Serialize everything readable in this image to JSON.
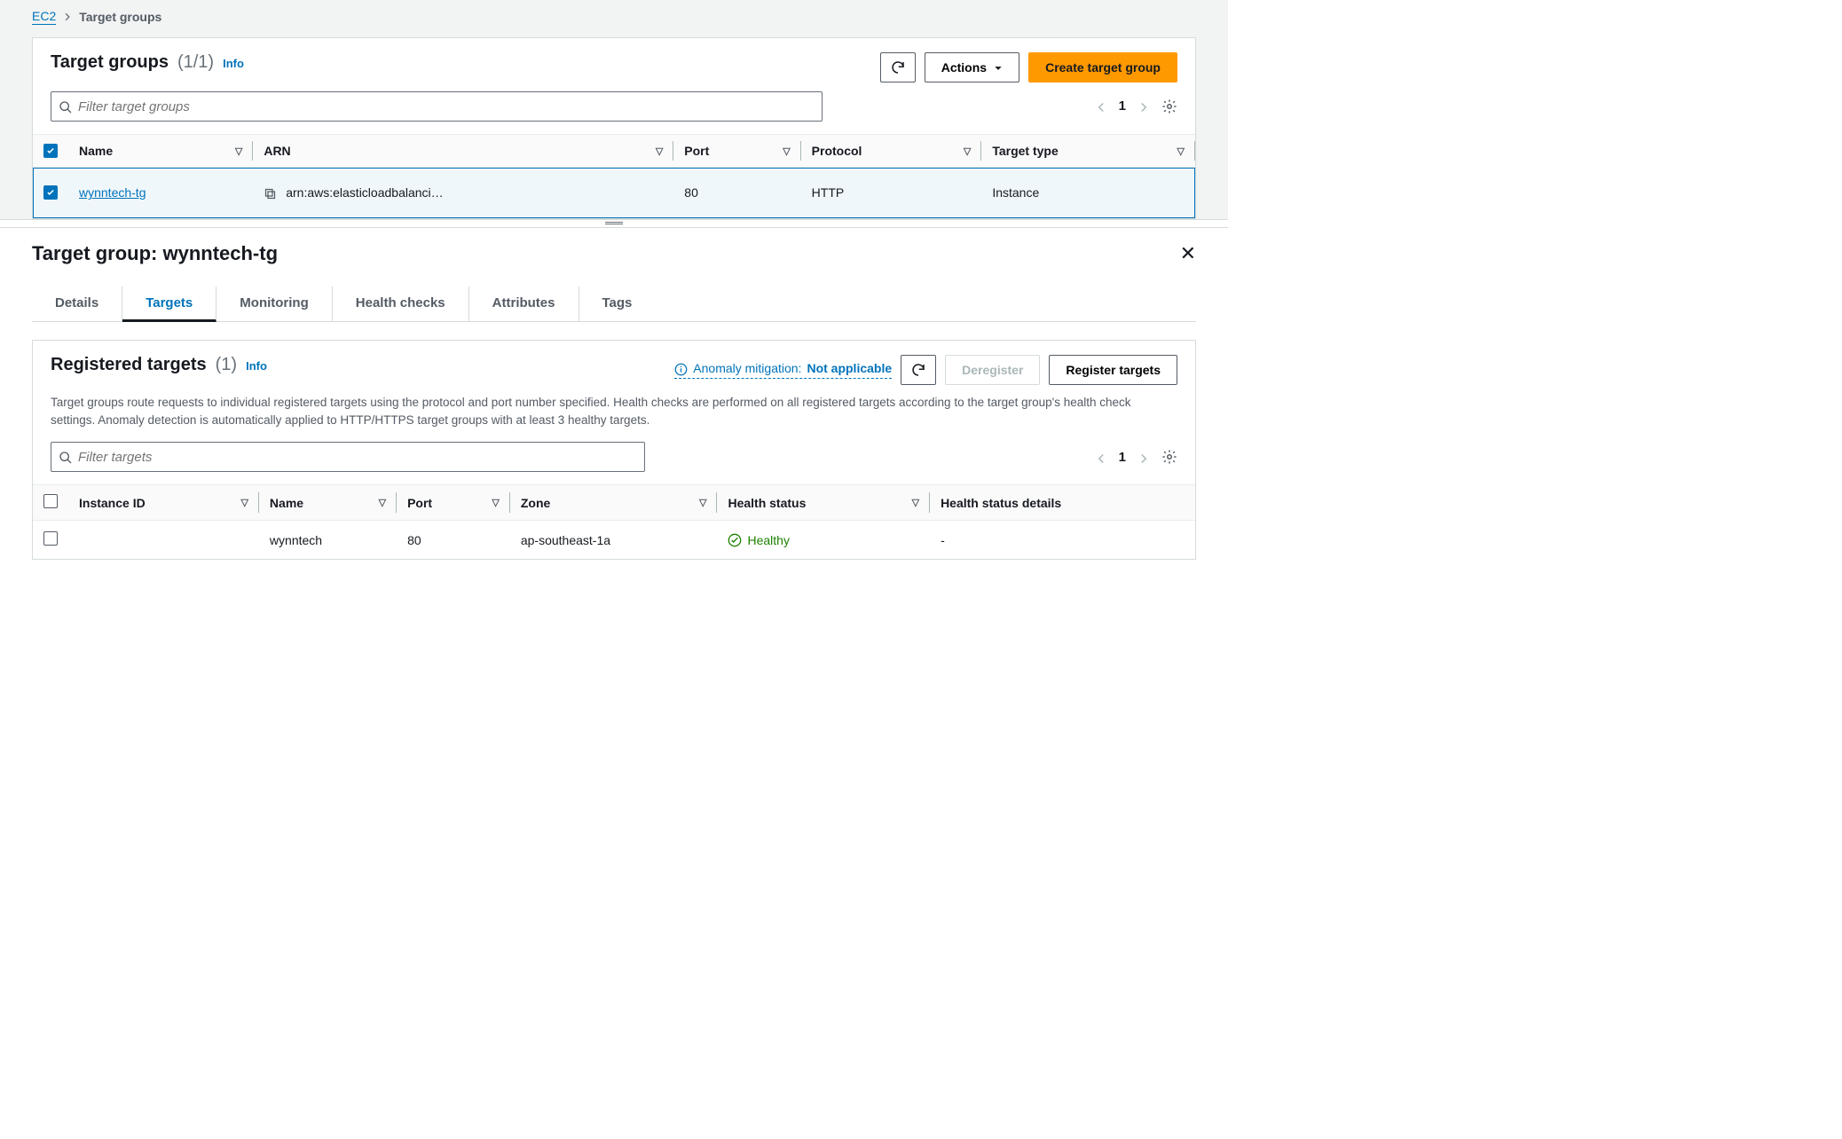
{
  "breadcrumb": {
    "root": "EC2",
    "current": "Target groups"
  },
  "tg_panel": {
    "title": "Target groups",
    "count": "(1/1)",
    "info": "Info",
    "actions_label": "Actions",
    "create_label": "Create target group",
    "filter_placeholder": "Filter target groups",
    "page": "1",
    "columns": {
      "name": "Name",
      "arn": "ARN",
      "port": "Port",
      "protocol": "Protocol",
      "target_type": "Target type"
    },
    "row": {
      "name": "wynntech-tg",
      "arn": "arn:aws:elasticloadbalanci…",
      "port": "80",
      "protocol": "HTTP",
      "target_type": "Instance"
    }
  },
  "detail": {
    "title_prefix": "Target group: ",
    "title_name": "wynntech-tg",
    "tabs": {
      "details": "Details",
      "targets": "Targets",
      "monitoring": "Monitoring",
      "health": "Health checks",
      "attributes": "Attributes",
      "tags": "Tags"
    }
  },
  "targets": {
    "title": "Registered targets",
    "count": "(1)",
    "info": "Info",
    "anomaly_label": "Anomaly mitigation: ",
    "anomaly_value": "Not applicable",
    "deregister": "Deregister",
    "register": "Register targets",
    "desc": "Target groups route requests to individual registered targets using the protocol and port number specified. Health checks are performed on all registered targets according to the target group's health check settings. Anomaly detection is automatically applied to HTTP/HTTPS target groups with at least 3 healthy targets.",
    "filter_placeholder": "Filter targets",
    "page": "1",
    "columns": {
      "instance_id": "Instance ID",
      "name": "Name",
      "port": "Port",
      "zone": "Zone",
      "health": "Health status",
      "health_details": "Health status details"
    },
    "row": {
      "instance_id": "",
      "name": "wynntech",
      "port": "80",
      "zone": "ap-southeast-1a",
      "health": "Healthy",
      "health_details": "-"
    }
  }
}
